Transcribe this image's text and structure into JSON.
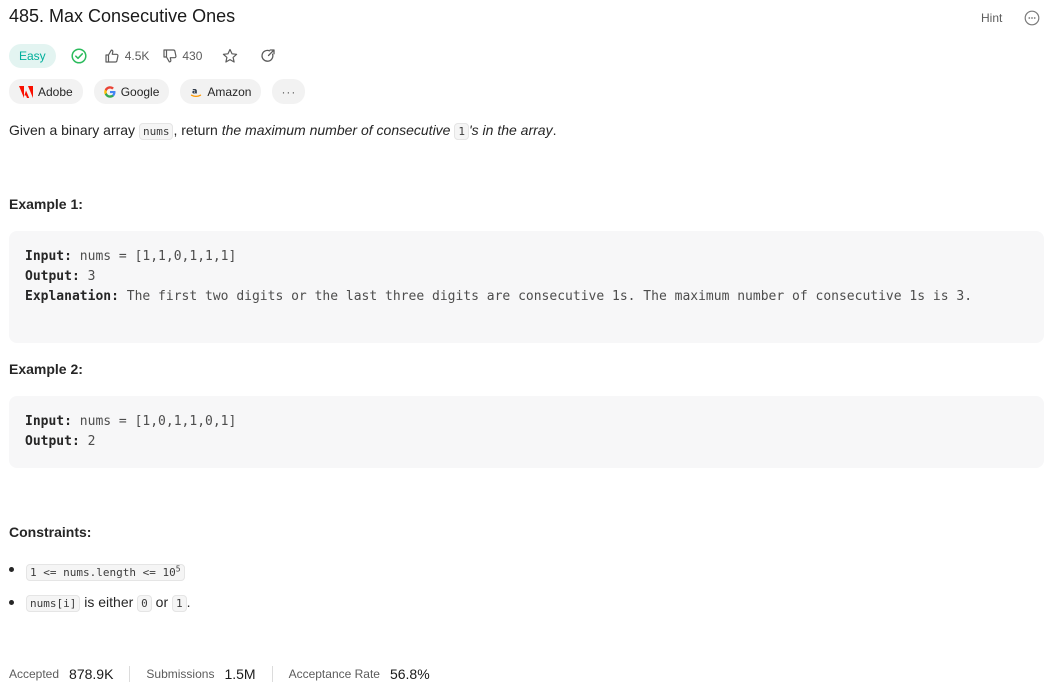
{
  "problem": {
    "title": "485. Max Consecutive Ones",
    "hint_label": "Hint",
    "difficulty": "Easy",
    "likes": "4.5K",
    "dislikes": "430"
  },
  "companies": [
    {
      "name": "Adobe"
    },
    {
      "name": "Google"
    },
    {
      "name": "Amazon"
    }
  ],
  "more_label": "···",
  "description": {
    "p1": "Given a binary array ",
    "code1": "nums",
    "p2": ", return ",
    "em1": "the maximum number of consecutive ",
    "code2": "1",
    "em2": "'s in the array",
    "p3": "."
  },
  "examples": [
    {
      "heading": "Example 1:",
      "input_label": "Input:",
      "input": " nums = [1,1,0,1,1,1]",
      "output_label": "Output:",
      "output": " 3",
      "explanation_label": "Explanation:",
      "explanation": " The first two digits or the last three digits are consecutive 1s. The maximum number of consecutive 1s is 3."
    },
    {
      "heading": "Example 2:",
      "input_label": "Input:",
      "input": " nums = [1,0,1,1,0,1]",
      "output_label": "Output:",
      "output": " 2"
    }
  ],
  "constraints": {
    "heading": "Constraints:",
    "c1_code": "1 <= nums.length <= 10",
    "c1_sup": "5",
    "c2_code": "nums[i]",
    "c2_text1": " is either ",
    "c2_code2": "0",
    "c2_text2": " or ",
    "c2_code3": "1",
    "c2_text3": "."
  },
  "stats": {
    "accepted_label": "Accepted",
    "accepted": "878.9K",
    "submissions_label": "Submissions",
    "submissions": "1.5M",
    "rate_label": "Acceptance Rate",
    "rate": "56.8%"
  },
  "colors": {
    "easy": "#00af9b",
    "solved": "#2cbb5d",
    "adobe": "#fa0f00",
    "amazon": "#ff9900"
  }
}
